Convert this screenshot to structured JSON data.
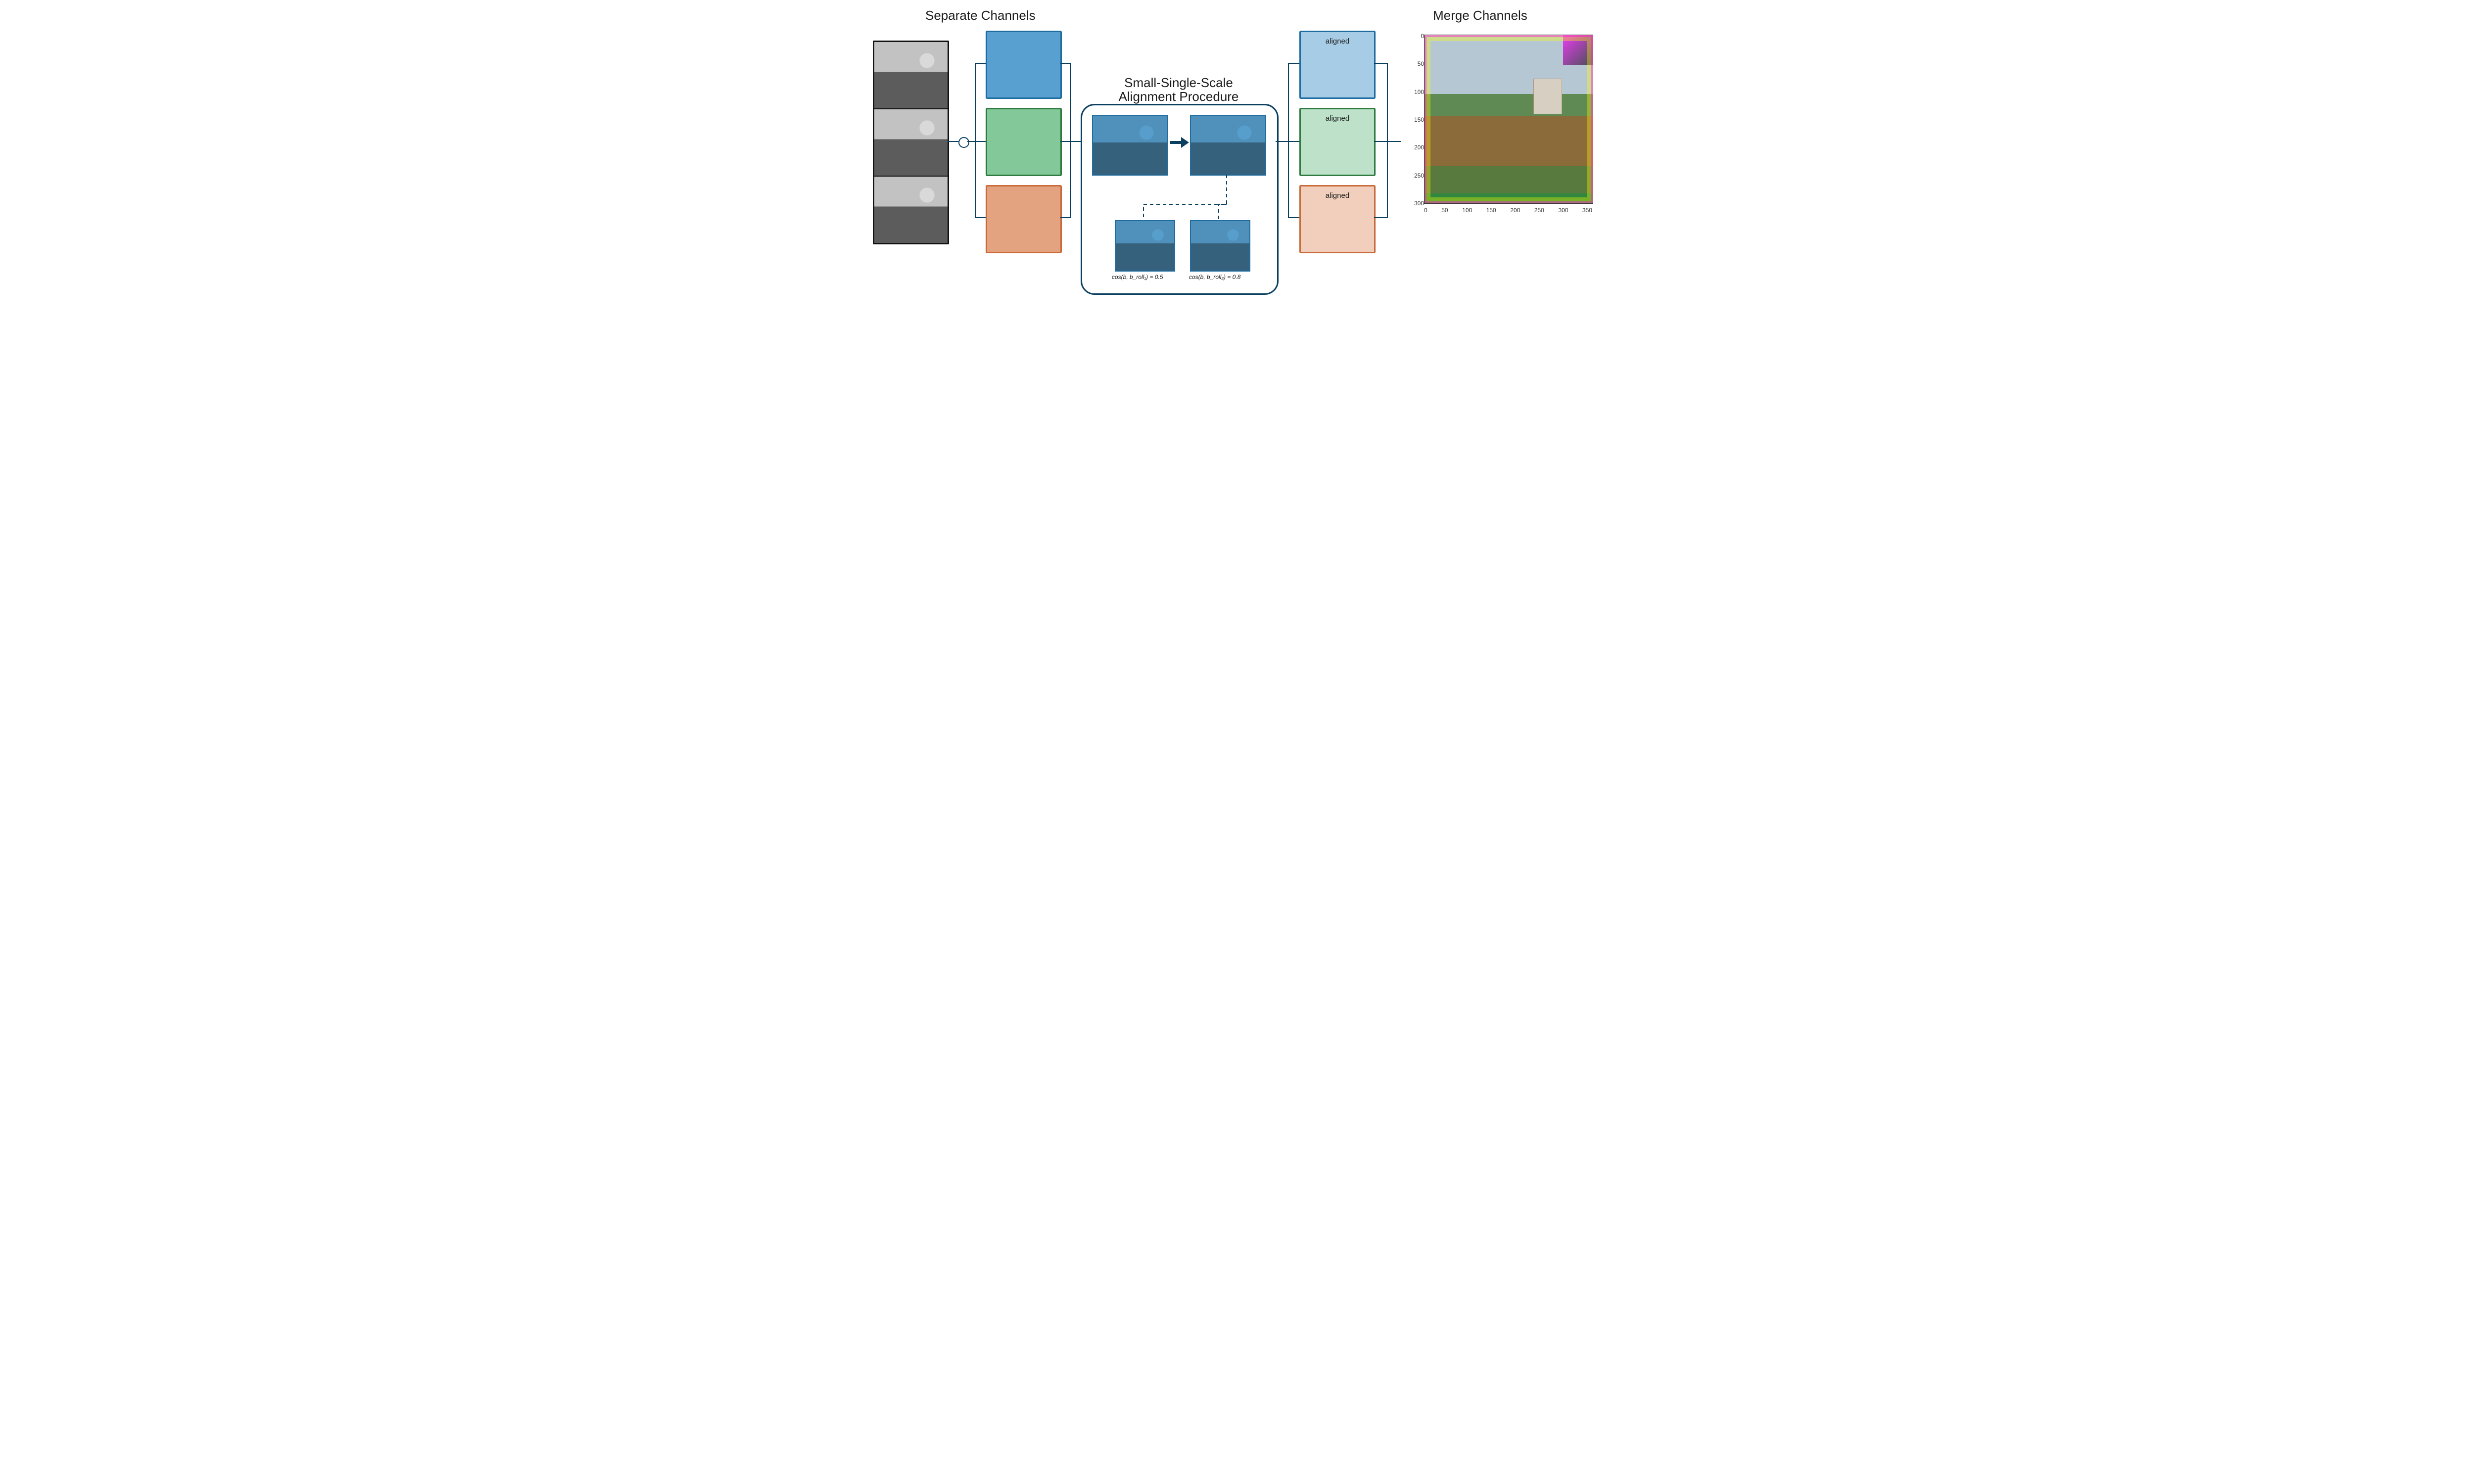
{
  "titles": {
    "separate": "Separate Channels",
    "procedure_line1": "Small-Single-Scale",
    "procedure_line2": "Alignment Procedure",
    "merge": "Merge Channels"
  },
  "aligned_label": "aligned",
  "procedure": {
    "formula_a": "cos(b, b_roll₁) = 0.5",
    "formula_b": "cos(b, b_roll₂) = 0.8"
  },
  "chart_data": {
    "type": "scatter",
    "title": "",
    "xlabel": "",
    "ylabel": "",
    "x_ticks": [
      0,
      50,
      100,
      150,
      200,
      250,
      300,
      350
    ],
    "y_ticks": [
      0,
      50,
      100,
      150,
      200,
      250,
      300
    ],
    "xlim": [
      0,
      380
    ],
    "ylim": [
      0,
      340
    ],
    "note": "Merged RGB image shown as a raster; axis ticks are pixel coordinates with origin at top-left."
  },
  "colors": {
    "line": "#0b3f5f",
    "blue": "#3a8fc7",
    "green": "#6cbf86",
    "orange": "#e0936a"
  }
}
